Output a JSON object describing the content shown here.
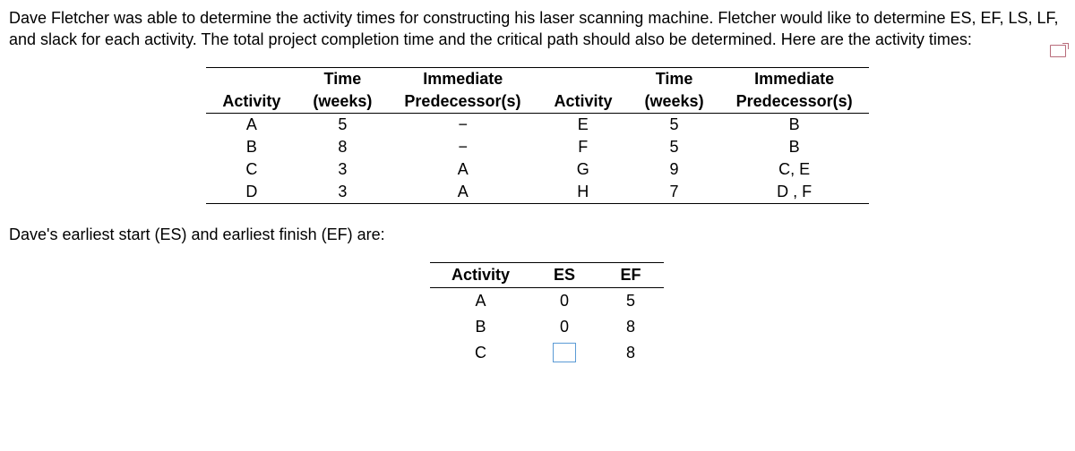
{
  "problem_text": "Dave Fletcher was able to determine the activity times for constructing his laser scanning machine. Fletcher would like to determine ES, EF, LS, LF, and slack for each activity. The total project completion time and the critical path should also be determined. Here are the activity times:",
  "main_table": {
    "headers": {
      "activity": "Activity",
      "time": "Time",
      "time_unit": "(weeks)",
      "immediate": "Immediate",
      "predecessor": "Predecessor(s)"
    },
    "left_rows": [
      {
        "activity": "A",
        "time": "5",
        "pred": "−"
      },
      {
        "activity": "B",
        "time": "8",
        "pred": "−"
      },
      {
        "activity": "C",
        "time": "3",
        "pred": "A"
      },
      {
        "activity": "D",
        "time": "3",
        "pred": "A"
      }
    ],
    "right_rows": [
      {
        "activity": "E",
        "time": "5",
        "pred": "B"
      },
      {
        "activity": "F",
        "time": "5",
        "pred": "B"
      },
      {
        "activity": "G",
        "time": "9",
        "pred": "C, E"
      },
      {
        "activity": "H",
        "time": "7",
        "pred": "D , F"
      }
    ]
  },
  "subheading": "Dave's earliest start (ES) and earliest finish (EF) are:",
  "es_ef_table": {
    "headers": {
      "activity": "Activity",
      "es": "ES",
      "ef": "EF"
    },
    "rows": [
      {
        "activity": "A",
        "es": "0",
        "ef": "5",
        "es_is_input": false
      },
      {
        "activity": "B",
        "es": "0",
        "ef": "8",
        "es_is_input": false
      },
      {
        "activity": "C",
        "es": "",
        "ef": "8",
        "es_is_input": true
      }
    ]
  }
}
